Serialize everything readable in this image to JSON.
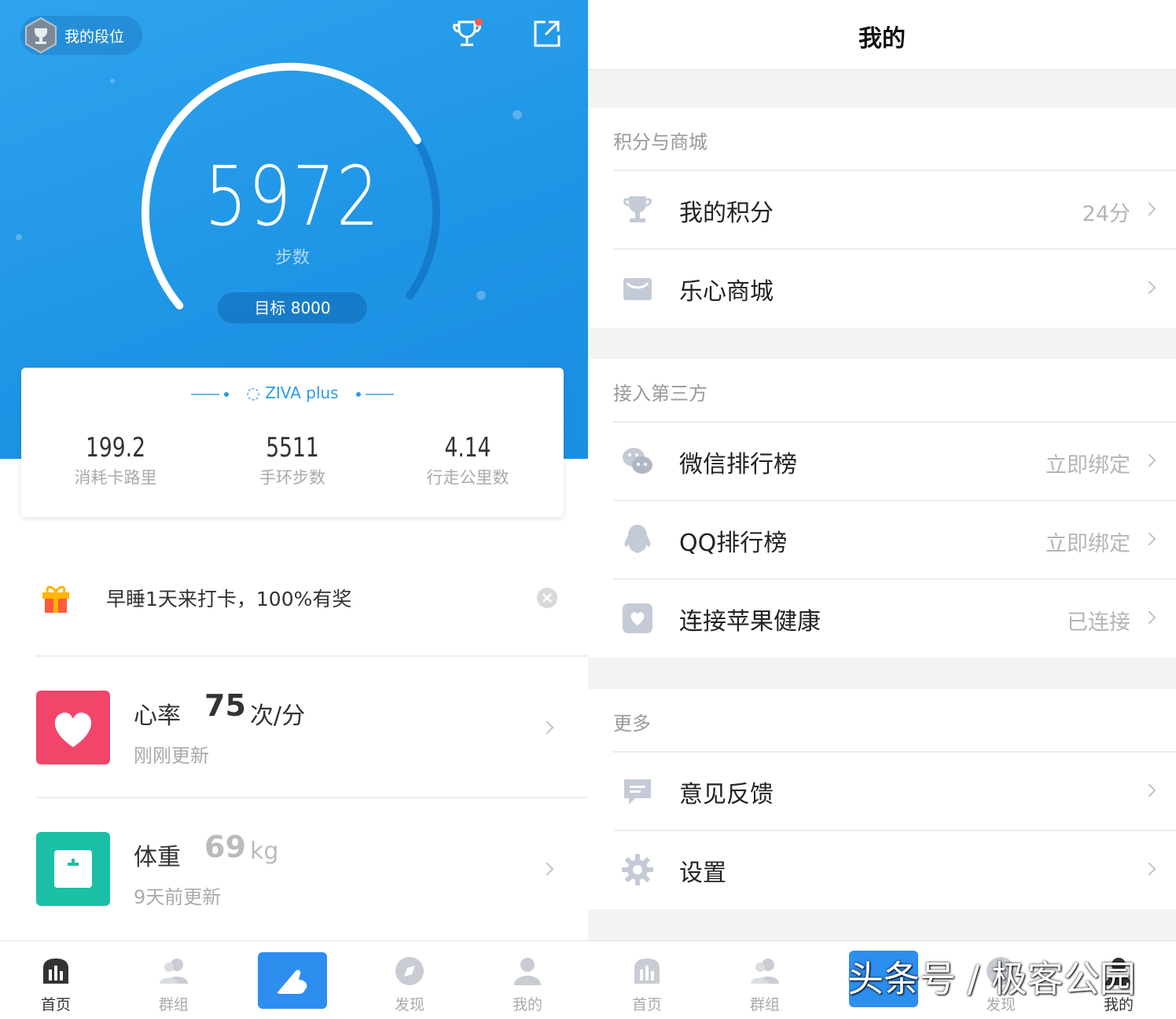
{
  "left": {
    "header": {
      "rank_label": "我的段位"
    },
    "steps": {
      "value": "5972",
      "unit": "步数",
      "goal": "目标 8000",
      "progress": 0.7465
    },
    "device": {
      "name": "ZIVA plus",
      "stats": [
        {
          "value": "199.2",
          "label": "消耗卡路里"
        },
        {
          "value": "5511",
          "label": "手环步数"
        },
        {
          "value": "4.14",
          "label": "行走公里数"
        }
      ]
    },
    "promo": {
      "text": "早睡1天来打卡，100%有奖"
    },
    "heart": {
      "name": "心率",
      "value": "75",
      "unit": "次/分",
      "sub": "刚刚更新"
    },
    "weight": {
      "name": "体重",
      "value": "69",
      "unit": "kg",
      "sub": "9天前更新"
    },
    "tabs": [
      "首页",
      "群组",
      "发现",
      "我的"
    ]
  },
  "right": {
    "title": "我的",
    "groups": [
      {
        "header": "积分与商城",
        "rows": [
          {
            "label": "我的积分",
            "value": "24分",
            "icon": "trophy-icon"
          },
          {
            "label": "乐心商城",
            "value": "",
            "icon": "shop-bag-icon"
          }
        ]
      },
      {
        "header": "接入第三方",
        "rows": [
          {
            "label": "微信排行榜",
            "value": "立即绑定",
            "icon": "wechat-icon"
          },
          {
            "label": "QQ排行榜",
            "value": "立即绑定",
            "icon": "qq-penguin-icon"
          },
          {
            "label": "连接苹果健康",
            "value": "已连接",
            "icon": "apple-health-icon"
          }
        ]
      },
      {
        "header": "更多",
        "rows": [
          {
            "label": "意见反馈",
            "value": "",
            "icon": "feedback-icon"
          },
          {
            "label": "设置",
            "value": "",
            "icon": "gear-icon"
          }
        ]
      }
    ],
    "tabs": [
      "首页",
      "群组",
      "发现",
      "我的"
    ]
  },
  "watermark": "头条号 / 极客公园",
  "colors": {
    "primary_blue": "#1f95e6",
    "heart_red": "#f2456a",
    "weight_teal": "#1bbfa5",
    "icon_grey": "#c4cad6"
  }
}
